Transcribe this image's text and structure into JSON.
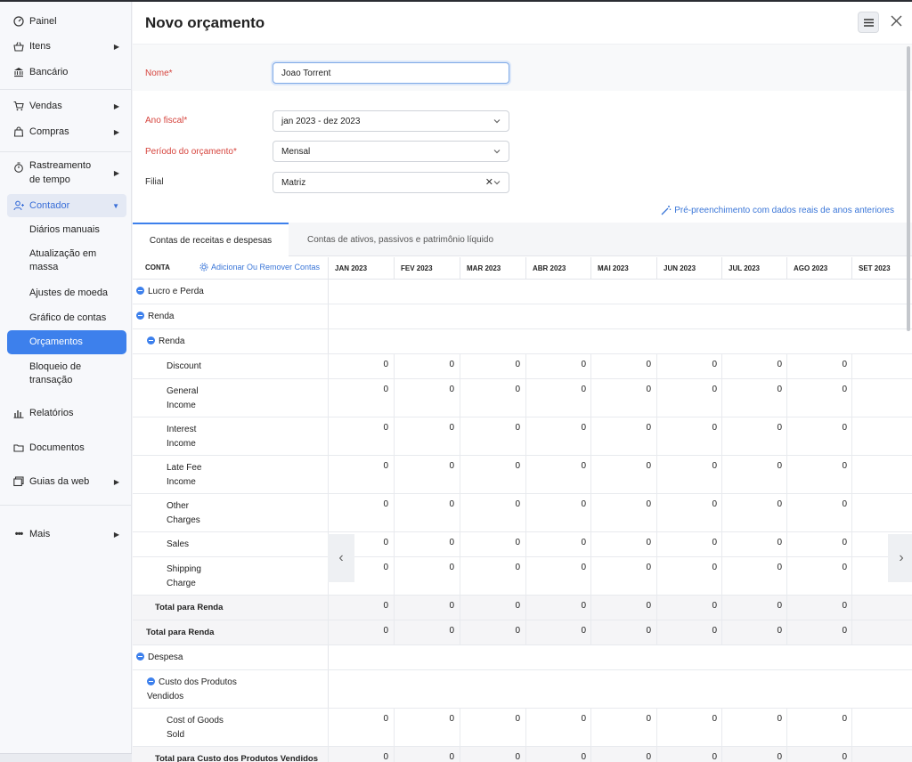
{
  "sidebar": {
    "items": [
      {
        "label": "Painel",
        "icon": "dashboard-icon"
      },
      {
        "label": "Itens",
        "icon": "basket-icon"
      },
      {
        "label": "Bancário",
        "icon": "bank-icon"
      },
      {
        "label": "Vendas",
        "icon": "cart-icon"
      },
      {
        "label": "Compras",
        "icon": "bag-icon"
      },
      {
        "label": "Rastreamento de tempo",
        "icon": "stopwatch-icon"
      },
      {
        "label": "Contador",
        "icon": "accountant-icon"
      },
      {
        "label": "Relatórios",
        "icon": "bar-chart-icon"
      },
      {
        "label": "Documentos",
        "icon": "folder-icon"
      },
      {
        "label": "Guias da web",
        "icon": "web-tabs-icon"
      },
      {
        "label": "Mais",
        "icon": "more-icon"
      }
    ],
    "contador_subitems": [
      "Diários manuais",
      "Atualização em massa",
      "Ajustes de moeda",
      "Gráfico de contas",
      "Orçamentos",
      "Bloqueio de transação"
    ],
    "accent_color": "#3d80ec"
  },
  "header": {
    "title": "Novo orçamento"
  },
  "form": {
    "name_label": "Nome*",
    "name_value": "Joao Torrent",
    "fiscal_year_label": "Ano fiscal*",
    "fiscal_year_value": "jan 2023 - dez 2023",
    "period_label": "Período do orçamento*",
    "period_value": "Mensal",
    "branch_label": "Filial",
    "branch_value": "Matriz",
    "prefill_link": "Pré-preenchimento com dados reais de anos anteriores"
  },
  "tabs": {
    "income_expense": "Contas de receitas e despesas",
    "assets_liabilities": "Contas de ativos, passivos e patrimônio líquido"
  },
  "table": {
    "account_header": "CONTA",
    "add_remove_link": "Adicionar Ou Remover Contas",
    "months": [
      "JAN 2023",
      "FEV 2023",
      "MAR 2023",
      "ABR 2023",
      "MAI 2023",
      "JUN 2023",
      "JUL 2023",
      "AGO 2023",
      "SET 2023"
    ],
    "rows": [
      {
        "label": "Lucro e Perda",
        "type": "group"
      },
      {
        "label": "Renda",
        "type": "group"
      },
      {
        "label": "Renda",
        "type": "subgroup"
      },
      {
        "label": "Discount",
        "type": "account",
        "values": [
          "0",
          "0",
          "0",
          "0",
          "0",
          "0",
          "0",
          "0"
        ]
      },
      {
        "label": "General Income",
        "type": "account",
        "values": [
          "0",
          "0",
          "0",
          "0",
          "0",
          "0",
          "0",
          "0"
        ]
      },
      {
        "label": "Interest Income",
        "type": "account",
        "values": [
          "0",
          "0",
          "0",
          "0",
          "0",
          "0",
          "0",
          "0"
        ]
      },
      {
        "label": "Late Fee Income",
        "type": "account",
        "values": [
          "0",
          "0",
          "0",
          "0",
          "0",
          "0",
          "0",
          "0"
        ]
      },
      {
        "label": "Other Charges",
        "type": "account",
        "values": [
          "0",
          "0",
          "0",
          "0",
          "0",
          "0",
          "0",
          "0"
        ]
      },
      {
        "label": "Sales",
        "type": "account",
        "values": [
          "0",
          "0",
          "0",
          "0",
          "0",
          "0",
          "0",
          "0"
        ]
      },
      {
        "label": "Shipping Charge",
        "type": "account",
        "values": [
          "0",
          "0",
          "0",
          "0",
          "0",
          "0",
          "0",
          "0"
        ]
      },
      {
        "label": "Total para Renda",
        "type": "subtotal",
        "values": [
          "0",
          "0",
          "0",
          "0",
          "0",
          "0",
          "0",
          "0"
        ]
      },
      {
        "label": "Total para Renda",
        "type": "total",
        "values": [
          "0",
          "0",
          "0",
          "0",
          "0",
          "0",
          "0",
          "0"
        ]
      },
      {
        "label": "Despesa",
        "type": "group"
      },
      {
        "label": "Custo dos Produtos Vendidos",
        "type": "subgroup"
      },
      {
        "label": "Cost of Goods Sold",
        "type": "account",
        "values": [
          "0",
          "0",
          "0",
          "0",
          "0",
          "0",
          "0",
          "0"
        ]
      },
      {
        "label": "Total para Custo dos Produtos Vendidos",
        "type": "subtotal",
        "values": [
          "0",
          "0",
          "0",
          "0",
          "0",
          "0",
          "0",
          "0"
        ]
      }
    ]
  }
}
